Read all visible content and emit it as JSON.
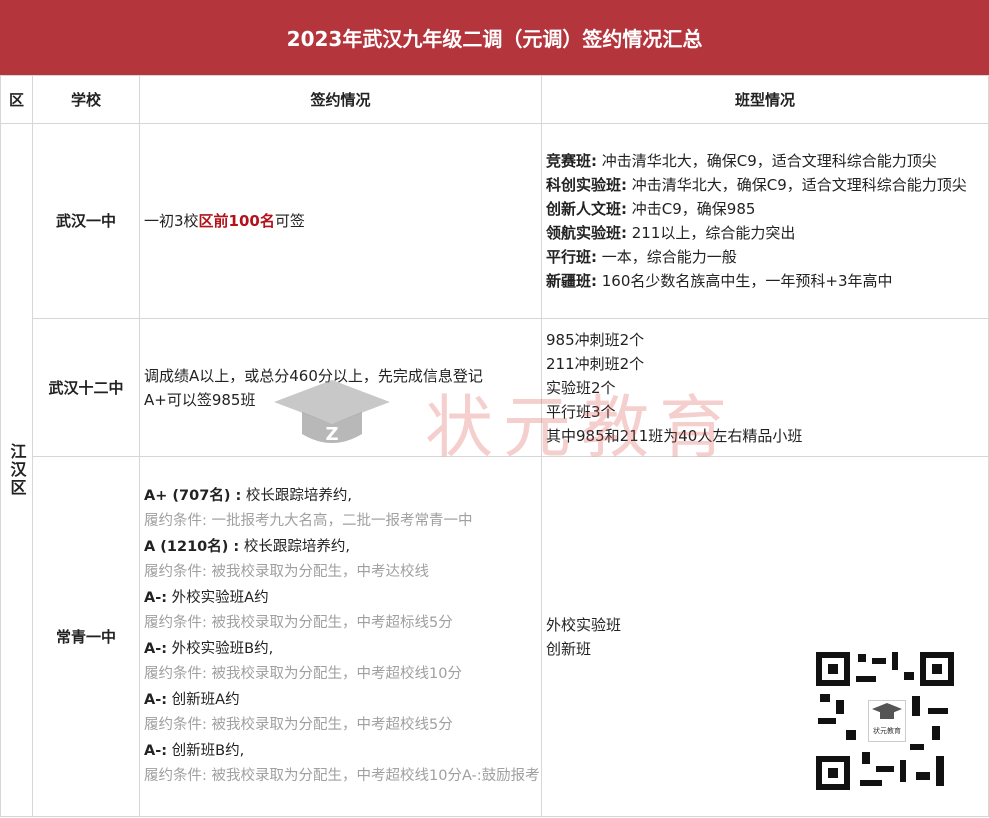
{
  "title": "2023年武汉九年级二调（元调）签约情况汇总",
  "headers": {
    "district": "区",
    "school": "学校",
    "sign": "签约情况",
    "class": "班型情况"
  },
  "district": "江汉区",
  "watermark": "状元教育",
  "colors": {
    "title_bg": "#b5353d",
    "highlight": "#b3121b"
  },
  "rows": [
    {
      "school": "武汉一中",
      "sign": {
        "pre": "一初3校",
        "highlight": "区前100名",
        "post": "可签"
      },
      "classes": [
        {
          "name": "竞赛班:",
          "desc": " 冲击清华北大，确保C9，适合文理科综合能力顶尖"
        },
        {
          "name": "科创实验班:",
          "desc": " 冲击清华北大，确保C9，适合文理科综合能力顶尖"
        },
        {
          "name": "创新人文班:",
          "desc": " 冲击C9，确保985"
        },
        {
          "name": "领航实验班:",
          "desc": " 211以上，综合能力突出"
        },
        {
          "name": "平行班:",
          "desc": " 一本，综合能力一般"
        },
        {
          "name": "新疆班:",
          "desc": " 160名少数名族高中生，一年预科+3年高中"
        }
      ]
    },
    {
      "school": "武汉十二中",
      "sign_lines": [
        "调成绩A以上，或总分460分以上，先完成信息登记",
        "A+可以签985班"
      ],
      "class_lines": [
        "985冲刺班2个",
        "211冲刺班2个",
        "实验班2个",
        "平行班3个",
        "其中985和211班为40人左右精品小班"
      ]
    },
    {
      "school": "常青一中",
      "sign_items": [
        {
          "head": "A+ (707名) :",
          "text": " 校长跟踪培养约,",
          "cond": "履约条件: 一批报考九大名高，二批一报考常青一中"
        },
        {
          "head": "A (1210名) :",
          "text": " 校长跟踪培养约,",
          "cond": "履约条件: 被我校录取为分配生，中考达校线"
        },
        {
          "head": "A-:",
          "text": " 外校实验班A约",
          "cond": "履约条件: 被我校录取为分配生，中考超标线5分"
        },
        {
          "head": "A-:",
          "text": " 外校实验班B约,",
          "cond": "履约条件: 被我校录取为分配生，中考超校线10分"
        },
        {
          "head": "A-:",
          "text": " 创新班A约",
          "cond": "履约条件: 被我校录取为分配生，中考超校线5分"
        },
        {
          "head": "A-:",
          "text": " 创新班B约,",
          "cond": "履约条件: 被我校录取为分配生，中考超校线10分A-:鼓励报考"
        }
      ],
      "class_lines": [
        "外校实验班",
        "创新班"
      ]
    }
  ],
  "qr_logo_text": "状元教育"
}
